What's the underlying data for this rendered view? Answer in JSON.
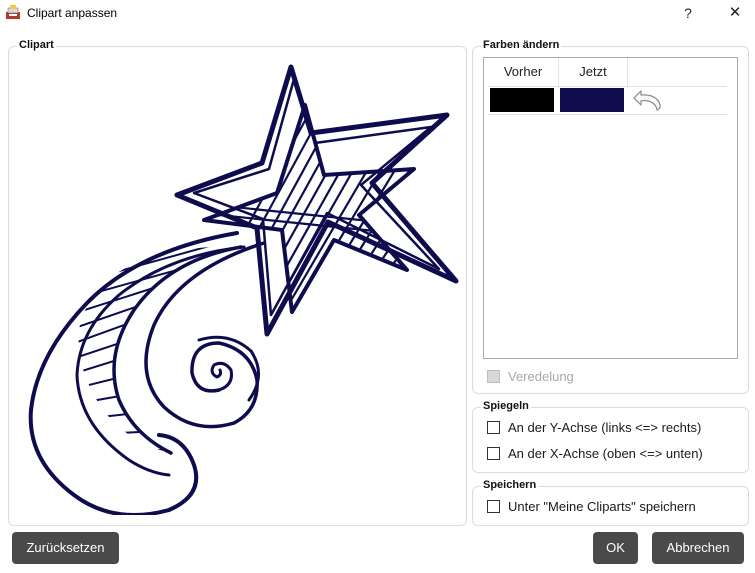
{
  "window": {
    "title": "Clipart anpassen",
    "help_label": "?",
    "close_label": "✕"
  },
  "clipart": {
    "label": "Clipart",
    "image_icon": "shooting-star-clipart"
  },
  "colors": {
    "label": "Farben ändern",
    "columns": [
      "Vorher",
      "Jetzt"
    ],
    "rows": [
      {
        "before": "#000000",
        "after": "#0f0c4e",
        "action_icon": "undo-arrow-icon"
      }
    ],
    "veredelung_label": "Veredelung",
    "veredelung_checked": false,
    "veredelung_enabled": false
  },
  "mirror": {
    "label": "Spiegeln",
    "y_axis_label": "An der Y-Achse (links <=> rechts)",
    "x_axis_label": "An der X-Achse (oben <=> unten)"
  },
  "save": {
    "label": "Speichern",
    "save_clipart_label": "Unter \"Meine Cliparts\" speichern"
  },
  "buttons": {
    "reset": "Zurücksetzen",
    "ok": "OK",
    "cancel": "Abbrechen"
  }
}
